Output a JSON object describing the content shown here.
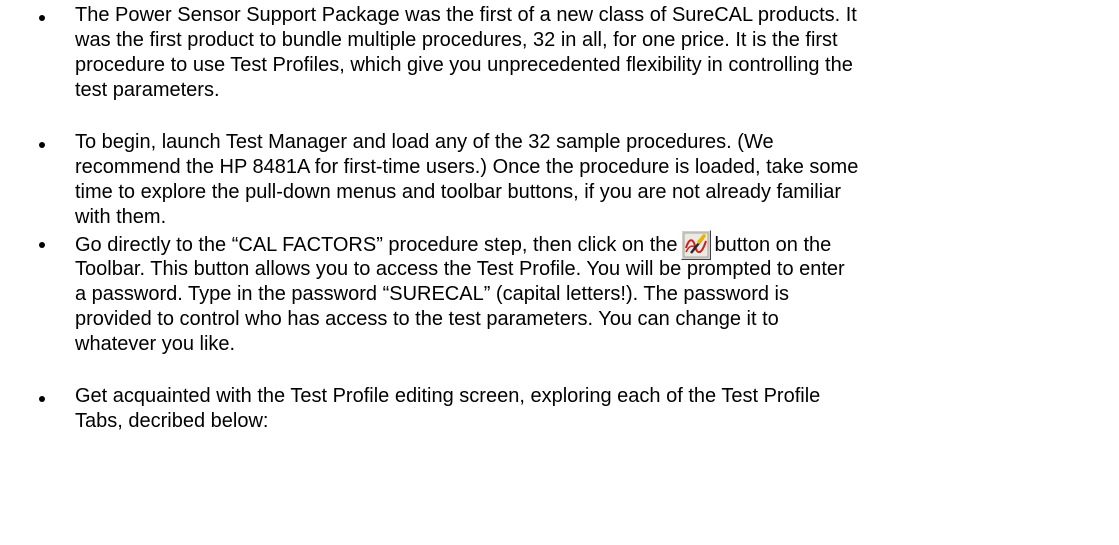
{
  "bullets": [
    {
      "lines": [
        "The Power Sensor Support Package was the first of a new class of SureCAL products.  It",
        "was the first product to bundle multiple procedures, 32 in all, for one price.  It is the first",
        "procedure to use Test Profiles, which give you unprecedented flexibility in controlling the",
        "test parameters."
      ]
    },
    {
      "lines": [
        "To begin, launch Test Manager and load any of the 32 sample procedures.  (We",
        "recommend the HP 8481A for first-time users.)  Once the procedure is loaded, take some",
        "time to explore the pull-down menus and toolbar buttons, if you are not already familiar",
        "with them."
      ]
    },
    {
      "first_before_icon": "Go directly to the “CAL FACTORS” procedure step, then click on the",
      "first_after_icon": "button on the",
      "icon": "test-profile-toolbar-icon",
      "lines": [
        "Toolbar.  This button allows you to access the Test Profile.  You will be prompted to enter",
        "a password.  Type in the password “SURECAL” (capital letters!).  The password is",
        "provided to control who has access to the test parameters.  You can change it to",
        "whatever you like."
      ]
    },
    {
      "lines": [
        "Get acquainted with the Test Profile editing screen, exploring each of the Test Profile",
        "Tabs, decribed below:"
      ]
    }
  ]
}
